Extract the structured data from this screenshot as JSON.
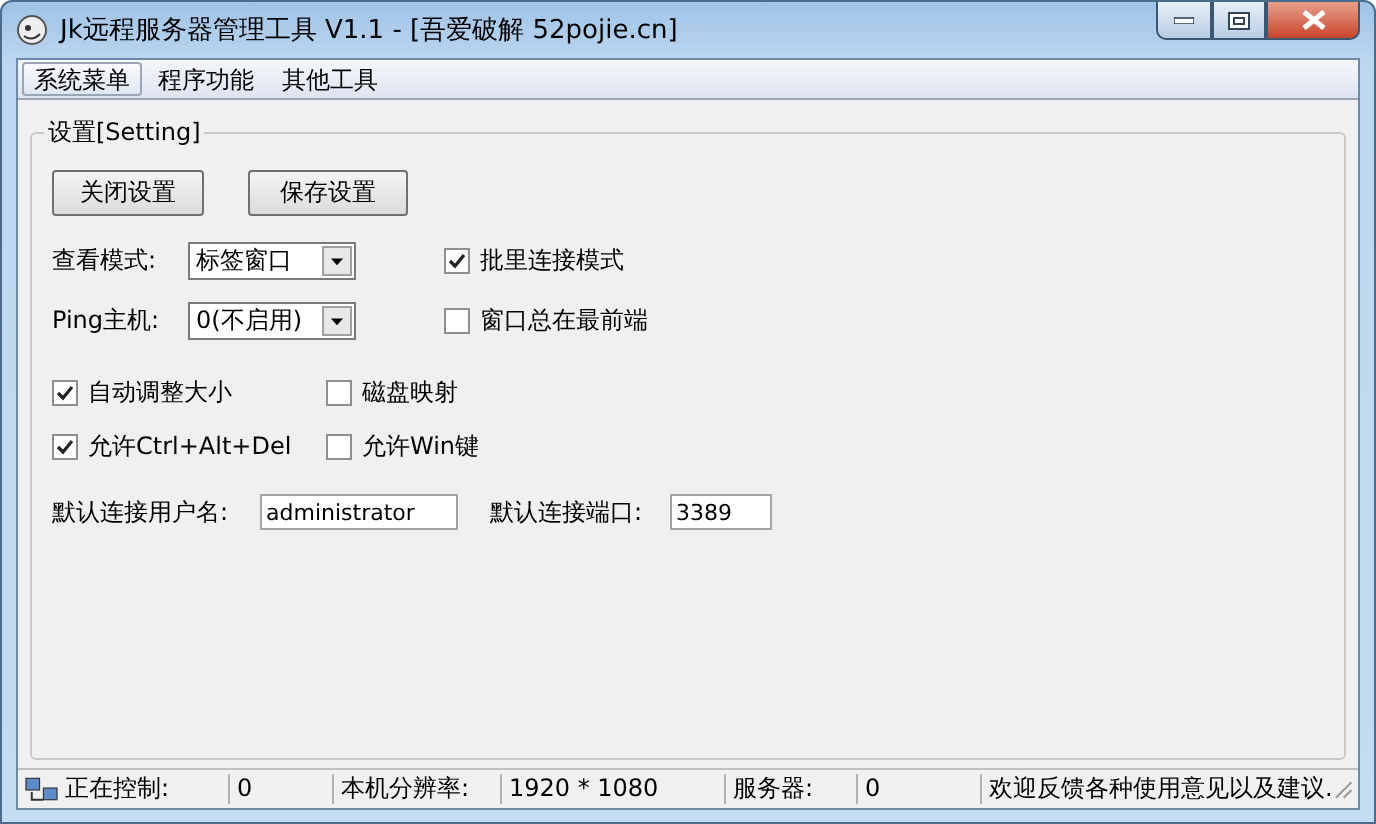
{
  "window": {
    "title": "Jk远程服务器管理工具 V1.1 - [吾爱破解 52pojie.cn]"
  },
  "menu": [
    {
      "label": "系统菜单",
      "highlighted": true
    },
    {
      "label": "程序功能",
      "highlighted": false
    },
    {
      "label": "其他工具",
      "highlighted": false
    }
  ],
  "settings": {
    "title": "设置[Setting]",
    "buttons": [
      "关闭设置",
      "保存设置"
    ],
    "view_mode": {
      "label": "查看模式:",
      "value": "标签窗口"
    },
    "ping_host": {
      "label": "Ping主机:",
      "value": "0(不启用)"
    },
    "checkboxes": [
      {
        "label": "批里连接模式",
        "checked": true
      },
      {
        "label": "窗口总在最前端",
        "checked": false
      },
      {
        "label": "自动调整大小",
        "checked": true
      },
      {
        "label": "磁盘映射",
        "checked": false
      },
      {
        "label": "允许Ctrl+Alt+Del",
        "checked": true
      },
      {
        "label": "允许Win键",
        "checked": false
      }
    ],
    "username": {
      "label": "默认连接用户名:",
      "value": "administrator"
    },
    "port": {
      "label": "默认连接端口:",
      "value": "3389"
    }
  },
  "status_bar": [
    {
      "text": "正在控制:"
    },
    {
      "text": "0"
    },
    {
      "text": "本机分辨率:"
    },
    {
      "text": "1920 * 1080"
    },
    {
      "text": "服务器:"
    },
    {
      "text": "0"
    },
    {
      "text": "欢迎反馈各种使用意见以及建议."
    }
  ]
}
